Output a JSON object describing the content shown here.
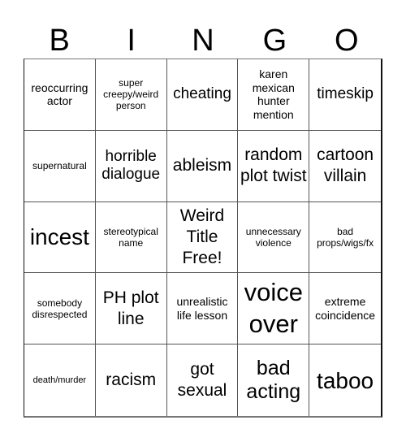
{
  "header": {
    "letters": [
      "B",
      "I",
      "N",
      "G",
      "O"
    ]
  },
  "cells": [
    "reoccurring actor",
    "super creepy/weird person",
    "cheating",
    "karen mexican hunter mention",
    "timeskip",
    "supernatural",
    "horrible dialogue",
    "ableism",
    "random plot twist",
    "cartoon villain",
    "incest",
    "stereotypical name",
    "Weird Title Free!",
    "unnecessary violence",
    "bad props/wigs/fx",
    "somebody disrespected",
    "PH plot line",
    "unrealistic life lesson",
    "voice over",
    "extreme coincidence",
    "death/murder",
    "racism",
    "got sexual",
    "bad acting",
    "taboo"
  ]
}
